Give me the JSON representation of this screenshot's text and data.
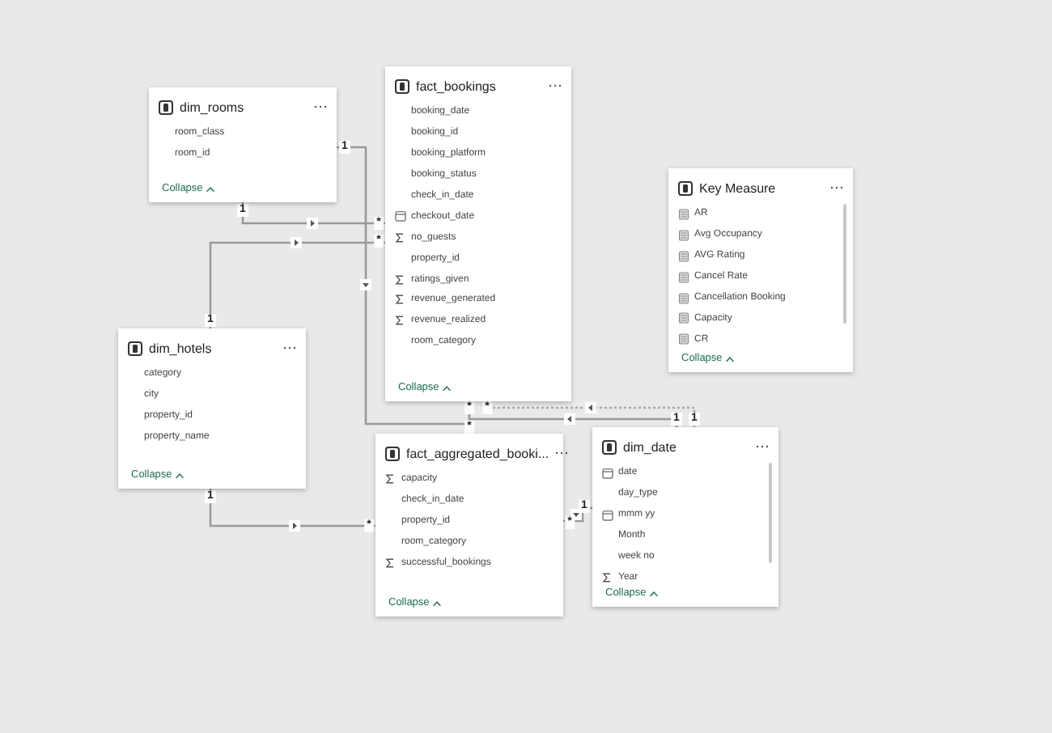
{
  "tables": [
    {
      "name": "dim_rooms",
      "scrollable": false,
      "fields": [
        {
          "name": "room_class",
          "kind": "plain"
        },
        {
          "name": "room_id",
          "kind": "plain"
        }
      ],
      "collapse": "Collapse"
    },
    {
      "name": "fact_bookings",
      "scrollable": false,
      "fields": [
        {
          "name": "booking_date",
          "kind": "plain"
        },
        {
          "name": "booking_id",
          "kind": "plain"
        },
        {
          "name": "booking_platform",
          "kind": "plain"
        },
        {
          "name": "booking_status",
          "kind": "plain"
        },
        {
          "name": "check_in_date",
          "kind": "plain"
        },
        {
          "name": "checkout_date",
          "kind": "calendar"
        },
        {
          "name": "no_guests",
          "kind": "sigma"
        },
        {
          "name": "property_id",
          "kind": "plain"
        },
        {
          "name": "ratings_given",
          "kind": "sigma"
        },
        {
          "name": "revenue_generated",
          "kind": "sigma"
        },
        {
          "name": "revenue_realized",
          "kind": "sigma"
        },
        {
          "name": "room_category",
          "kind": "plain"
        }
      ],
      "collapse": "Collapse"
    },
    {
      "name": "Key Measure",
      "scrollable": true,
      "fields": [
        {
          "name": "AR",
          "kind": "measure"
        },
        {
          "name": "Avg Occupancy",
          "kind": "measure"
        },
        {
          "name": "AVG Rating",
          "kind": "measure"
        },
        {
          "name": "Cancel Rate",
          "kind": "measure"
        },
        {
          "name": "Cancellation Booking",
          "kind": "measure"
        },
        {
          "name": "Capacity",
          "kind": "measure"
        },
        {
          "name": "CR",
          "kind": "measure"
        }
      ],
      "collapse": "Collapse"
    },
    {
      "name": "dim_hotels",
      "scrollable": false,
      "fields": [
        {
          "name": "category",
          "kind": "plain"
        },
        {
          "name": "city",
          "kind": "plain"
        },
        {
          "name": "property_id",
          "kind": "plain"
        },
        {
          "name": "property_name",
          "kind": "plain"
        }
      ],
      "collapse": "Collapse"
    },
    {
      "name": "fact_aggregated_booki...",
      "scrollable": false,
      "fields": [
        {
          "name": "capacity",
          "kind": "sigma"
        },
        {
          "name": "check_in_date",
          "kind": "plain"
        },
        {
          "name": "property_id",
          "kind": "plain"
        },
        {
          "name": "room_category",
          "kind": "plain"
        },
        {
          "name": "successful_bookings",
          "kind": "sigma"
        }
      ],
      "collapse": "Collapse"
    },
    {
      "name": "dim_date",
      "scrollable": true,
      "fields": [
        {
          "name": "date",
          "kind": "calendar"
        },
        {
          "name": "day_type",
          "kind": "plain"
        },
        {
          "name": "mmm yy",
          "kind": "calendar"
        },
        {
          "name": "Month",
          "kind": "plain"
        },
        {
          "name": "week no",
          "kind": "plain"
        },
        {
          "name": "Year",
          "kind": "sigma"
        }
      ],
      "collapse": "Collapse"
    }
  ],
  "relationships": [
    {
      "from_label": "1",
      "to_label": "*",
      "active": true
    },
    {
      "from_label": "1",
      "to_label": "*",
      "active": true
    },
    {
      "from_label": "1",
      "to_label": "*",
      "active": true
    },
    {
      "from_label": "1",
      "to_label": "*",
      "active": true
    },
    {
      "from_label": "1",
      "to_label": "*",
      "active": true
    },
    {
      "from_label": "1",
      "to_label": "*",
      "active": false
    },
    {
      "from_label": "1",
      "to_label": "*",
      "active": true
    }
  ]
}
